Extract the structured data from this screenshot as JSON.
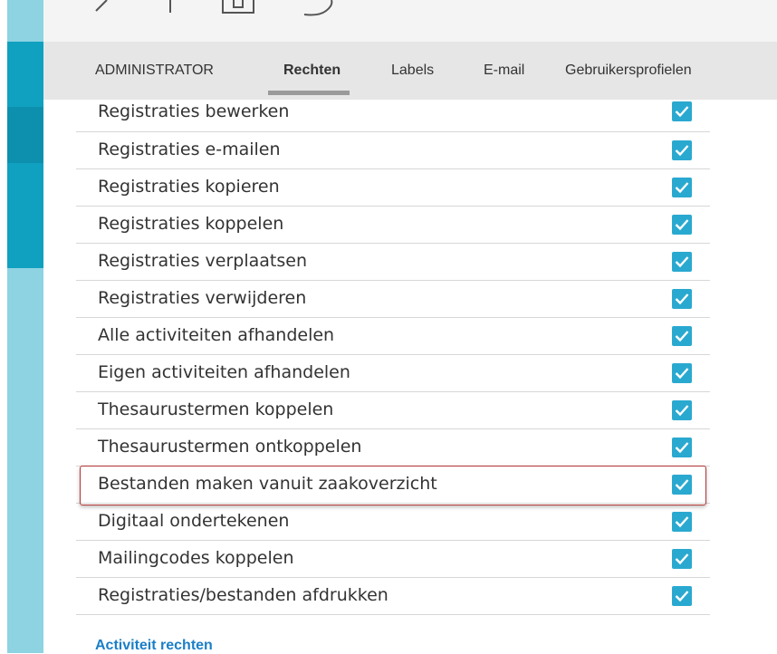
{
  "tabs": [
    {
      "label": "ADMINISTRATOR",
      "active": false
    },
    {
      "label": "Rechten",
      "active": true
    },
    {
      "label": "Labels",
      "active": false
    },
    {
      "label": "E-mail",
      "active": false
    },
    {
      "label": "Gebruikersprofielen",
      "active": false
    }
  ],
  "rights": [
    {
      "label": "Registraties bewerken",
      "checked": true
    },
    {
      "label": "Registraties e-mailen",
      "checked": true
    },
    {
      "label": "Registraties kopieren",
      "checked": true
    },
    {
      "label": "Registraties koppelen",
      "checked": true
    },
    {
      "label": "Registraties verplaatsen",
      "checked": true
    },
    {
      "label": "Registraties verwijderen",
      "checked": true
    },
    {
      "label": "Alle activiteiten afhandelen",
      "checked": true
    },
    {
      "label": "Eigen activiteiten afhandelen",
      "checked": true
    },
    {
      "label": "Thesaurustermen koppelen",
      "checked": true
    },
    {
      "label": "Thesaurustermen ontkoppelen",
      "checked": true
    },
    {
      "label": "Bestanden maken vanuit zaakoverzicht",
      "checked": true,
      "highlighted": true
    },
    {
      "label": "Digitaal ondertekenen",
      "checked": true
    },
    {
      "label": "Mailingcodes koppelen",
      "checked": true
    },
    {
      "label": "Registraties/bestanden afdrukken",
      "checked": true
    }
  ],
  "section_link": "Activiteit rechten",
  "colors": {
    "accent": "#2aa9d0",
    "sidebar": "#10a0c0",
    "highlight_border": "#b33434",
    "link": "#1a7fc7"
  },
  "icons": [
    "back-arrow-icon",
    "separator-icon",
    "box-icon",
    "swirl-icon",
    "checkmark-icon"
  ]
}
